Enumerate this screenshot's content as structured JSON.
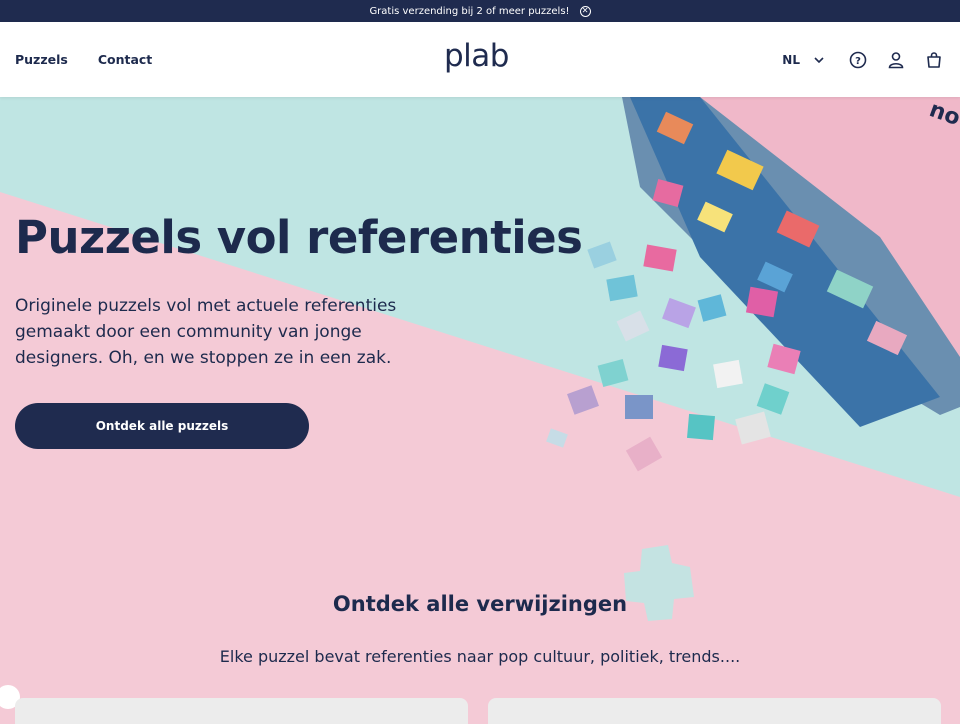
{
  "announcement": {
    "text": "Gratis verzending bij 2 of meer puzzels!"
  },
  "header": {
    "nav": [
      {
        "label": "Puzzels"
      },
      {
        "label": "Contact"
      }
    ],
    "logo": "plab",
    "language": "NL"
  },
  "hero": {
    "title": "Puzzels vol referenties",
    "subtitle": "Originele puzzels vol met actuele referenties gemaakt door een community van jonge designers. Oh, en we stoppen ze in een zak.",
    "cta": "Ontdek alle puzzels"
  },
  "section": {
    "title_part1": "Ontdek alle",
    "title_part2": "verwijzingen",
    "subtitle": "Elke puzzel bevat referenties naar pop cultuur, politiek, trends...."
  },
  "colors": {
    "navy": "#1f2b4f",
    "pink": "#f4cad6",
    "mint": "#bfe5e3",
    "highlight_yellow": "#f2d46f"
  }
}
